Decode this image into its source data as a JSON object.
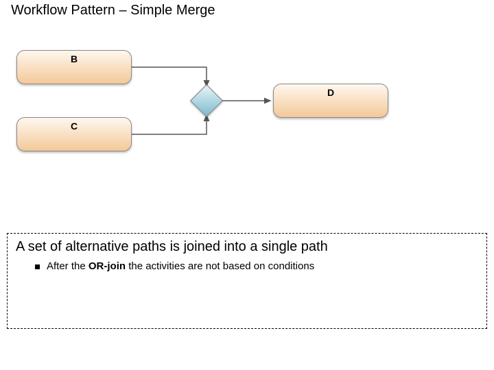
{
  "title": "Workflow Pattern – Simple Merge",
  "diagram": {
    "nodes": {
      "b": "B",
      "c": "C",
      "d": "D"
    }
  },
  "description": {
    "heading": "A set of alternative paths is joined into a single path",
    "bullet_prefix": "After the ",
    "bullet_bold": "OR-join",
    "bullet_suffix": " the activities are not based on conditions"
  }
}
